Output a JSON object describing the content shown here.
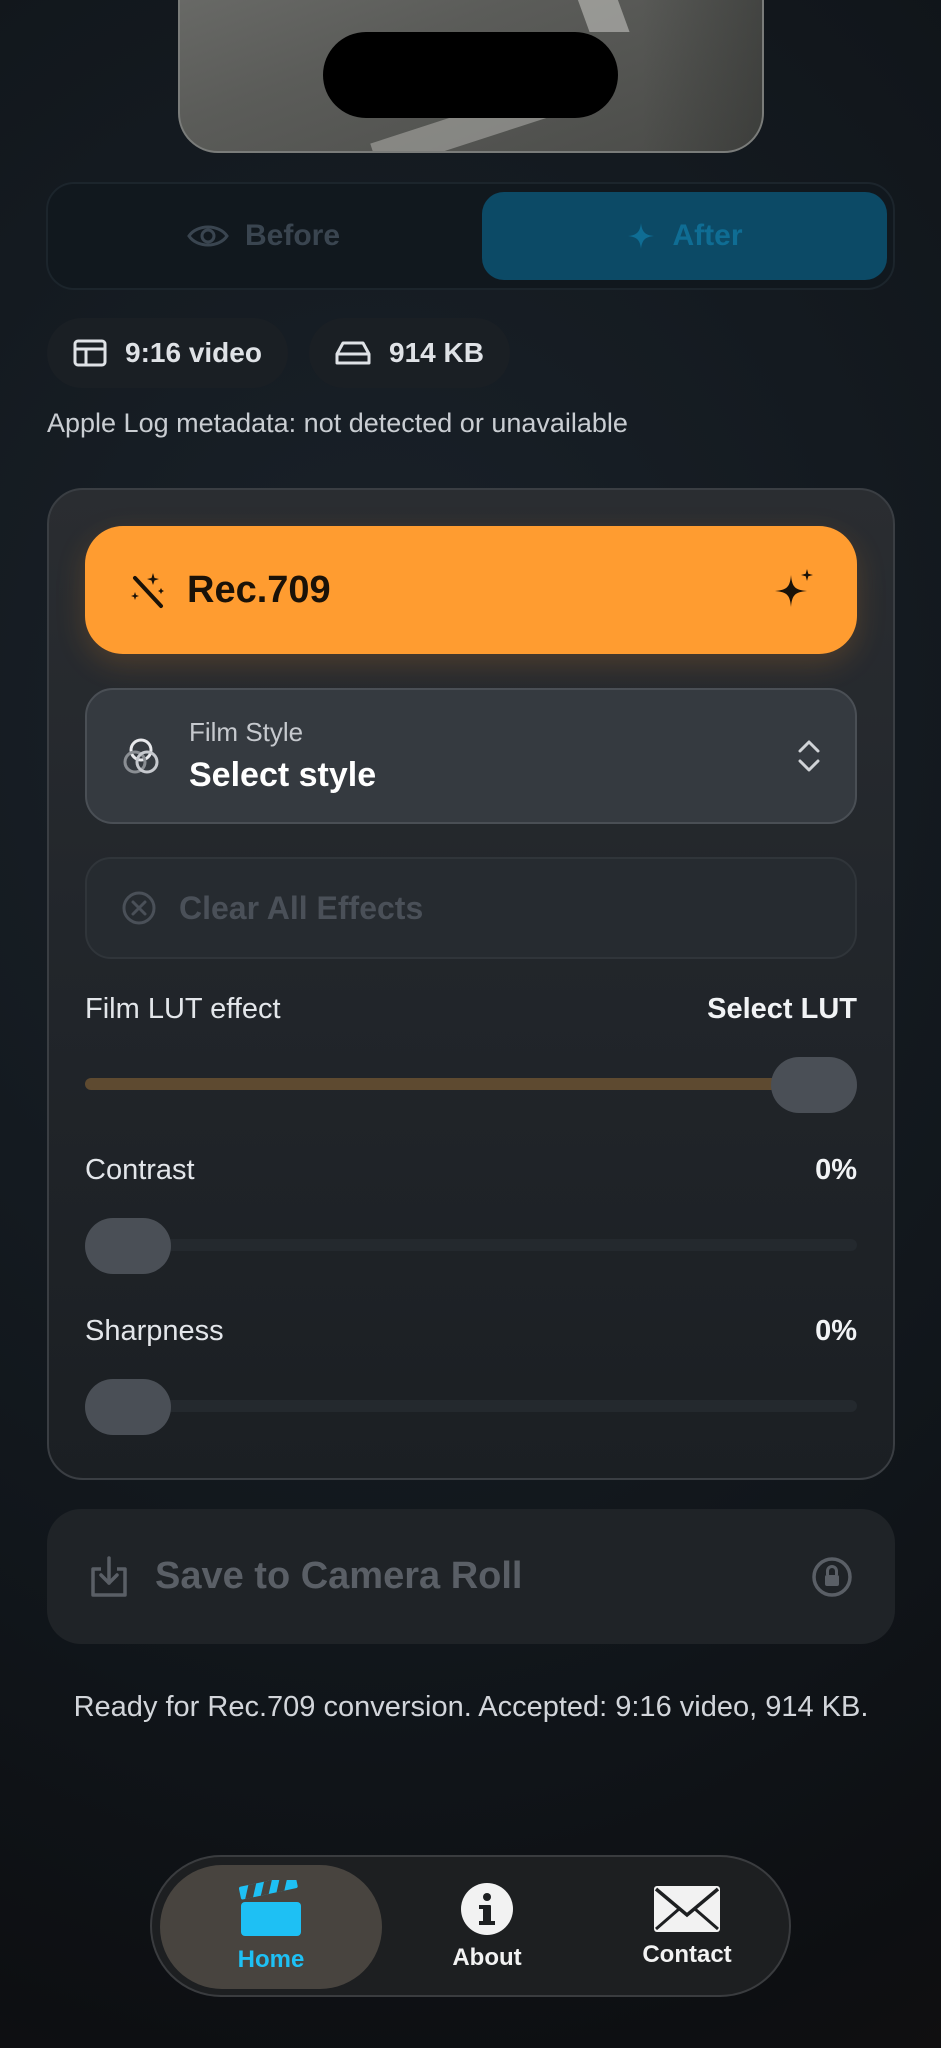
{
  "preview": {
    "mode": {
      "before_label": "Before",
      "after_label": "After"
    }
  },
  "chips": {
    "format": "9:16 video",
    "size": "914 KB"
  },
  "metadata_text": "Apple Log metadata: not detected or unavailable",
  "rec_button": {
    "label": "Rec.709"
  },
  "film_style": {
    "caption": "Film Style",
    "value": "Select style"
  },
  "clear_effects": {
    "label": "Clear All Effects"
  },
  "sliders": {
    "film_lut": {
      "label": "Film LUT effect",
      "value": "Select LUT",
      "level": 1.0
    },
    "contrast": {
      "label": "Contrast",
      "value": "0%",
      "level": 0
    },
    "sharpness": {
      "label": "Sharpness",
      "value": "0%",
      "level": 0
    }
  },
  "save": {
    "label": "Save to Camera Roll"
  },
  "status_text": "Ready for Rec.709 conversion. Accepted: 9:16 video, 914 KB.",
  "tabs": {
    "home": {
      "label": "Home",
      "selected": true
    },
    "about": {
      "label": "About"
    },
    "contact": {
      "label": "Contact"
    }
  },
  "colors": {
    "accent_orange": "#ff9c30",
    "accent_blue": "#1ec0f4",
    "after_active": "#0c4a66"
  },
  "icons": [
    "eye-icon",
    "sparkle-icon",
    "aspect-ratio-icon",
    "drive-icon",
    "magic-wand-icon",
    "sparkles-icon",
    "overlap-circles-icon",
    "chevron-updown-icon",
    "clear-circle-icon",
    "download-icon",
    "lock-icon",
    "clapperboard-icon",
    "info-icon",
    "envelope-icon"
  ]
}
